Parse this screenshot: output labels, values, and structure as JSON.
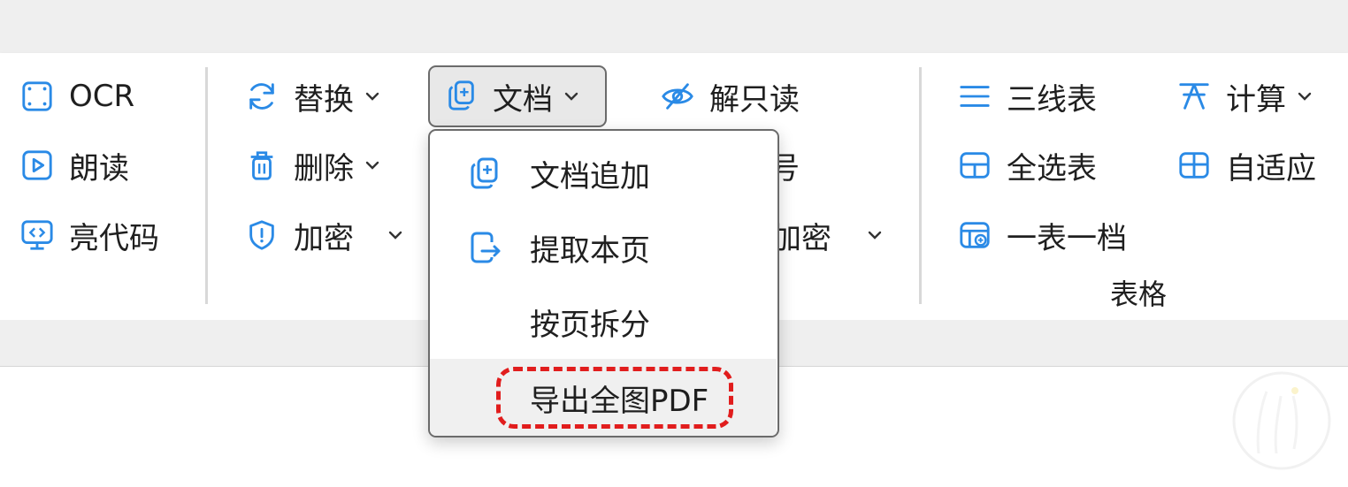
{
  "colors": {
    "accent": "#2a8ae6",
    "highlight_ring": "#e11d1d"
  },
  "ribbon": {
    "group1": [
      {
        "label": "OCR",
        "icon": "ocr-scan-icon"
      },
      {
        "label": "朗读",
        "icon": "read-aloud-play-icon"
      },
      {
        "label": "亮代码",
        "icon": "code-monitor-icon"
      }
    ],
    "group2": {
      "replace": {
        "label": "替换",
        "icon": "refresh-icon"
      },
      "delete": {
        "label": "删除",
        "icon": "trash-icon"
      },
      "encrypt": {
        "label": "加密",
        "icon": "shield-icon"
      },
      "document": {
        "label": "文档",
        "icon": "document-add-icon"
      },
      "unreadonly": {
        "label": "解只读",
        "icon": "eye-off-icon"
      },
      "partial_number": "号",
      "partial_encrypt": "加密"
    },
    "table_group": {
      "three_line": {
        "label": "三线表",
        "icon": "lines-icon"
      },
      "calculate": {
        "label": "计算",
        "icon": "formula-icon"
      },
      "select_all": {
        "label": "全选表",
        "icon": "table-icon"
      },
      "autofit": {
        "label": "自适应",
        "icon": "table-fit-icon"
      },
      "one_table": {
        "label": "一表一档",
        "icon": "table-export-icon"
      },
      "group_label": "表格"
    }
  },
  "dropdown": {
    "items": [
      {
        "label": "文档追加",
        "icon": "document-add-icon"
      },
      {
        "label": "提取本页",
        "icon": "extract-page-icon"
      },
      {
        "label": "按页拆分",
        "icon": ""
      },
      {
        "label": "导出全图PDF",
        "icon": ""
      }
    ],
    "highlighted_index": 3
  }
}
